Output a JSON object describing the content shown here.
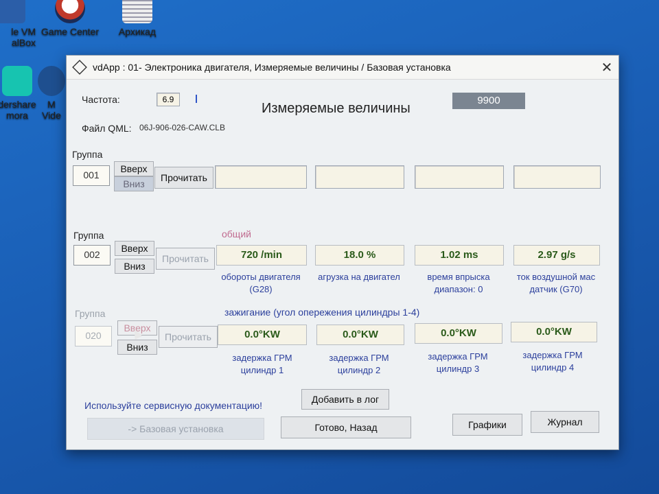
{
  "desktop": {
    "icons": [
      {
        "label": "le VM\nalBox"
      },
      {
        "label": "Game Center"
      },
      {
        "label": "Архикад"
      },
      {
        "label": "dershare\nmora"
      },
      {
        "label": "M\nVide"
      }
    ]
  },
  "window": {
    "title": "vdApp : 01- Электроника двигателя,  Измеряемые величины / Базовая установка",
    "close_glyph": "✕",
    "freq_label": "Частота:",
    "freq_value": "6.9",
    "heading": "Измеряемые величины",
    "counter": "9900",
    "file_label": "Файл QML:",
    "file_value": "06J-906-026-CAW.CLB",
    "groups": [
      {
        "label": "Группа",
        "number": "001",
        "up": "Вверх",
        "down": "Вниз",
        "read": "Прочитать",
        "values": [
          "",
          "",
          "",
          ""
        ]
      },
      {
        "label": "Группа",
        "number": "002",
        "up": "Вверх",
        "down": "Вниз",
        "read": "Прочитать",
        "section_title": "общий",
        "values": [
          "720 /min",
          "18.0 %",
          "1.02 ms",
          "2.97 g/s"
        ],
        "captions": [
          "обороты двигателя\n(G28)",
          "агрузка на двигател",
          "время впрыска\nдиапазон: 0",
          "ток воздушной мас\nдатчик (G70)"
        ]
      },
      {
        "label": "Группа",
        "number": "020",
        "up": "Вверх",
        "down": "Вниз",
        "read": "Прочитать",
        "section_title": "зажигание (угол опережения цилиндры 1-4)",
        "values": [
          "0.0°KW",
          "0.0°KW",
          "0.0°KW",
          "0.0°KW"
        ],
        "captions": [
          "задержка ГРМ\nцилиндр 1",
          "задержка ГРМ\nцилиндр 2",
          "задержка ГРМ\nцилиндр 3",
          "задержка ГРМ\nцилиндр 4"
        ]
      }
    ],
    "service_note": "Используйте сервисную документацию!",
    "add_log": "Добавить в лог",
    "basic_setting": "-> Базовая установка",
    "done_back": "Готово, Назад",
    "graphs": "Графики",
    "journal": "Журнал"
  }
}
